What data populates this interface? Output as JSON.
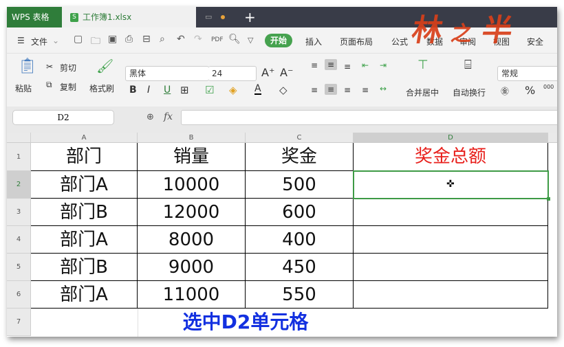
{
  "titlebar": {
    "app_name": "WPS 表格",
    "tab_label": "工作簿1.xlsx",
    "tab_icon": "S",
    "new_tab": "+"
  },
  "menubar": {
    "file": "文件",
    "start": "开始",
    "items": [
      "插入",
      "页面布局",
      "公式",
      "数据",
      "审阅",
      "视图",
      "安全"
    ]
  },
  "watermark": "林之半",
  "toolbar": {
    "paste": "粘贴",
    "cut": "剪切",
    "copy": "复制",
    "format_painter": "格式刷",
    "font_name": "黑体",
    "font_size": "24",
    "bold": "B",
    "italic": "I",
    "underline": "U",
    "merge_center": "合并居中",
    "wrap_text": "自动换行",
    "number_format": "常规",
    "percent": "%",
    "thousands": "000"
  },
  "formula_bar": {
    "name_box": "D2",
    "fx": "fx",
    "formula": ""
  },
  "sheet": {
    "columns": [
      "A",
      "B",
      "C",
      "D"
    ],
    "rows": [
      "1",
      "2",
      "3",
      "4",
      "5",
      "6",
      "7"
    ],
    "header": [
      "部门",
      "销量",
      "奖金",
      "奖金总额"
    ],
    "data": [
      [
        "部门A",
        "10000",
        "500",
        ""
      ],
      [
        "部门B",
        "12000",
        "600",
        ""
      ],
      [
        "部门A",
        "8000",
        "400",
        ""
      ],
      [
        "部门B",
        "9000",
        "450",
        ""
      ],
      [
        "部门A",
        "11000",
        "550",
        ""
      ]
    ],
    "selected_cell": "D2",
    "caption": "选中D2单元格"
  },
  "colors": {
    "accent": "#2f7d3a",
    "selection": "#3d9a45",
    "header_red": "#e8201c",
    "caption_blue": "#1230e0"
  }
}
